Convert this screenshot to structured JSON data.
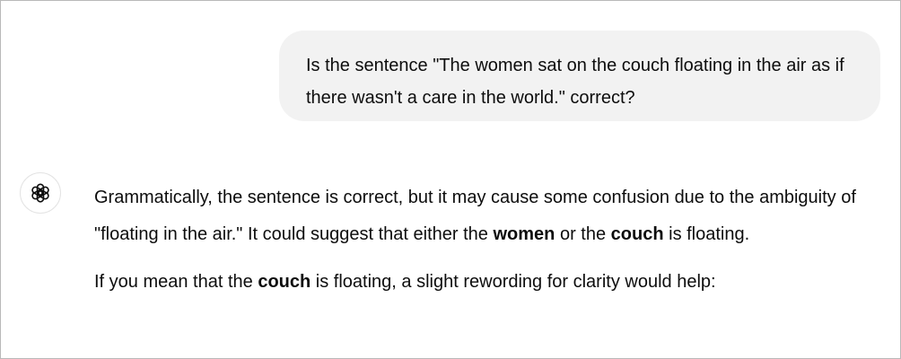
{
  "user_message": {
    "text": "Is the sentence \"The women sat on the couch floating in the air as if there wasn't a care in the world.\" correct?"
  },
  "assistant_avatar": {
    "icon": "openai-logo-icon"
  },
  "assistant_message": {
    "para1": {
      "part1": "Grammatically, the sentence is correct, but it may cause some confusion due to the ambiguity of \"floating in the air.\" It could suggest that either the ",
      "bold1": "women",
      "part2": " or the ",
      "bold2": "couch",
      "part3": " is floating."
    },
    "para2": {
      "part1": "If you mean that the ",
      "bold1": "couch",
      "part2": " is floating, a slight rewording for clarity would help:"
    }
  }
}
